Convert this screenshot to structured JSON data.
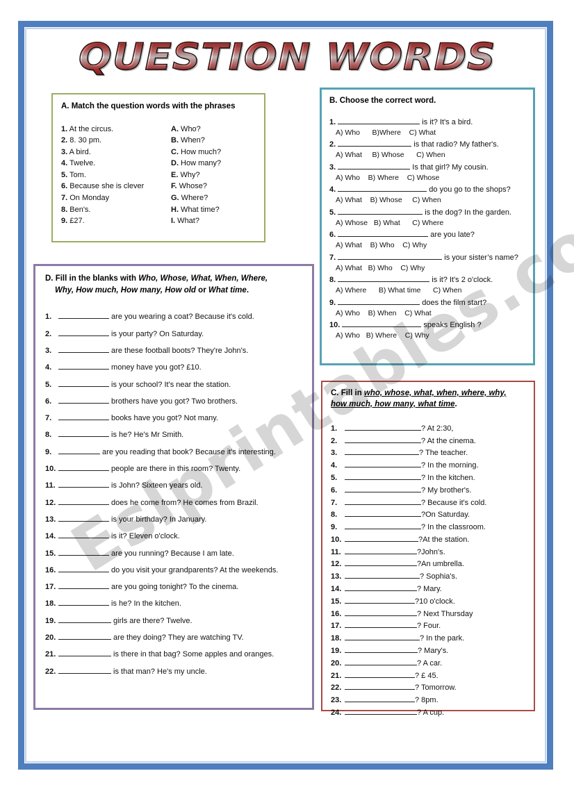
{
  "worksheet": {
    "title": "QUESTION WORDS",
    "watermark": "Eslprintables.com",
    "colors": {
      "frame_blue": "#4f7fbe",
      "box_a_green": "#9aad62",
      "box_b_teal": "#56a2b4",
      "box_c_red": "#a84a45",
      "box_d_purple": "#8c7aa6",
      "title_red": "#c23030"
    }
  },
  "section_a": {
    "heading": "A. Match the question words with the phrases",
    "left_items": [
      {
        "num": "1.",
        "text": "At the circus."
      },
      {
        "num": "2.",
        "text": "8. 30 pm."
      },
      {
        "num": "3.",
        "text": "A bird."
      },
      {
        "num": "4.",
        "text": "Twelve."
      },
      {
        "num": "5.",
        "text": "Tom."
      },
      {
        "num": "6.",
        "text": "Because she is clever"
      },
      {
        "num": "7.",
        "text": "On Monday"
      },
      {
        "num": "8.",
        "text": "Ben's."
      },
      {
        "num": "9.",
        "text": " £27."
      }
    ],
    "right_items": [
      {
        "num": "A.",
        "text": "Who?"
      },
      {
        "num": "B.",
        "text": "When?"
      },
      {
        "num": "C.",
        "text": "How much?"
      },
      {
        "num": "D.",
        "text": "How many?"
      },
      {
        "num": "E.",
        "text": "Why?"
      },
      {
        "num": "F.",
        "text": "Whose?"
      },
      {
        "num": "G.",
        "text": "Where?"
      },
      {
        "num": "H.",
        "text": "What time?"
      },
      {
        "num": "I.",
        "text": "What?"
      }
    ]
  },
  "section_b": {
    "heading": "B. Choose the correct word.",
    "items": [
      {
        "num": "1.",
        "blank_width": 118,
        "tail": "is it? It's a bird.",
        "options": "A) Who      B)Where    C) What"
      },
      {
        "num": "2.",
        "blank_width": 106,
        "tail": "is that radio? My father's.",
        "options": "A) What     B) Whose      C) When"
      },
      {
        "num": "3.",
        "blank_width": 104,
        "tail": "Is that girl? My cousin.",
        "options": "A) Who    B) Where    C) Whose"
      },
      {
        "num": "4.",
        "blank_width": 128,
        "tail": "do you go to the shops?",
        "options": "A) What    B) Whose     C) When"
      },
      {
        "num": "5.",
        "blank_width": 122,
        "tail": "is the dog? In the garden.",
        "options": "A) Whose   B) What      C) Where"
      },
      {
        "num": "6.",
        "blank_width": 130,
        "tail": "are you late?",
        "options": "A) What    B) Who    C) Why"
      },
      {
        "num": "7.",
        "blank_width": 150,
        "tail": "is your sister’s name?",
        "options": "A) What   B) Who    C) Why"
      },
      {
        "num": "8.",
        "blank_width": 132,
        "tail": "is it? It's 2 o'clock.",
        "options": "A) Where      B) What time      C) When"
      },
      {
        "num": "9.",
        "blank_width": 118,
        "tail": "does the film start?",
        "options": "A) Who    B) When    C) What"
      },
      {
        "num": "10.",
        "blank_width": 114,
        "tail": "speaks English ?",
        "options": "A) Who   B) Where    C) Why"
      }
    ]
  },
  "section_c": {
    "heading_prefix": "C. Fill in ",
    "heading_words_line1": "who, whose, what, when, where, why,",
    "heading_words_line2": "how much, how many, what time",
    "heading_suffix": ".",
    "items": [
      {
        "num": "1.",
        "blank_width": 110,
        "answer": "? At  2:30,"
      },
      {
        "num": "2.",
        "blank_width": 110,
        "answer": "? At the cinema."
      },
      {
        "num": "3.",
        "blank_width": 107,
        "answer": "? The teacher."
      },
      {
        "num": "4.",
        "blank_width": 110,
        "answer": "? In the morning."
      },
      {
        "num": "5.",
        "blank_width": 110,
        "answer": "? In the kitchen."
      },
      {
        "num": "6.",
        "blank_width": 110,
        "answer": "? My brother's."
      },
      {
        "num": "7.",
        "blank_width": 110,
        "answer": "? Because it's cold."
      },
      {
        "num": "8.",
        "blank_width": 110,
        "answer": "?On Saturday."
      },
      {
        "num": "9.",
        "blank_width": 110,
        "answer": "? In the classroom."
      },
      {
        "num": "10.",
        "blank_width": 106,
        "answer": "?At the station."
      },
      {
        "num": "11.",
        "blank_width": 104,
        "answer": "?John's."
      },
      {
        "num": "12.",
        "blank_width": 104,
        "answer": "?An umbrella."
      },
      {
        "num": "13.",
        "blank_width": 108,
        "answer": "? Sophia's."
      },
      {
        "num": "14.",
        "blank_width": 104,
        "answer": "? Mary."
      },
      {
        "num": "15.",
        "blank_width": 101,
        "answer": "?10 o'clock."
      },
      {
        "num": "16.",
        "blank_width": 104,
        "answer": "? Next Thursday"
      },
      {
        "num": "17.",
        "blank_width": 104,
        "answer": "? Four."
      },
      {
        "num": "18.",
        "blank_width": 108,
        "answer": "? In the park."
      },
      {
        "num": "19.",
        "blank_width": 105,
        "answer": "? Mary's."
      },
      {
        "num": "20.",
        "blank_width": 104,
        "answer": "? A car."
      },
      {
        "num": "21.",
        "blank_width": 101,
        "answer": "? £ 45."
      },
      {
        "num": "22.",
        "blank_width": 101,
        "answer": "? Tomorrow."
      },
      {
        "num": "23.",
        "blank_width": 101,
        "answer": "? 8pm."
      },
      {
        "num": "24.",
        "blank_width": 104,
        "answer": "? A cup."
      }
    ]
  },
  "section_d": {
    "heading_line1_prefix": "D. Fill in the blanks with ",
    "heading_line1_words": "Who, Whose, What, When, Where,",
    "heading_line2_words_a": "Why, How much, How many, How old",
    "heading_line2_mid": " or ",
    "heading_line2_words_b": "What time",
    "heading_line2_end": ".",
    "items": [
      {
        "num": "1.",
        "blank_width": 73,
        "tail": "are you wearing a coat? Because it's cold."
      },
      {
        "num": "2.",
        "blank_width": 73,
        "tail": "is your party? On Saturday."
      },
      {
        "num": "3.",
        "blank_width": 73,
        "tail": "are these football boots? They're John's."
      },
      {
        "num": "4.",
        "blank_width": 73,
        "tail": "money have you got? £10."
      },
      {
        "num": "5.",
        "blank_width": 73,
        "tail": "is your school? It's near the station."
      },
      {
        "num": "6.",
        "blank_width": 73,
        "tail": "brothers have you got? Two brothers."
      },
      {
        "num": "7.",
        "blank_width": 73,
        "tail": "books have you got? Not many."
      },
      {
        "num": "8.",
        "blank_width": 73,
        "tail": "is he? He's Mr Smith."
      },
      {
        "num": "9.",
        "blank_width": 60,
        "tail": "are you reading that book? Because it's interesting."
      },
      {
        "num": "10.",
        "blank_width": 73,
        "tail": "people are there in this room? Twenty."
      },
      {
        "num": "11.",
        "blank_width": 73,
        "tail": "is John? Sixteen years old."
      },
      {
        "num": "12.",
        "blank_width": 73,
        "tail": "does he come from? He comes from Brazil."
      },
      {
        "num": "13.",
        "blank_width": 73,
        "tail": "is your birthday? In January."
      },
      {
        "num": "14.",
        "blank_width": 73,
        "tail": "is it? Eleven o'clock."
      },
      {
        "num": "15.",
        "blank_width": 73,
        "tail": "are you running? Because I am late."
      },
      {
        "num": "16.",
        "blank_width": 73,
        "tail": "do you visit your grandparents? At the weekends."
      },
      {
        "num": "17.",
        "blank_width": 73,
        "tail": "are you going tonight? To the cinema."
      },
      {
        "num": "18.",
        "blank_width": 73,
        "tail": "is he? In the kitchen."
      },
      {
        "num": "19.",
        "blank_width": 76,
        "tail": "girls are there? Twelve."
      },
      {
        "num": "20.",
        "blank_width": 76,
        "tail": "are they doing? They are watching TV."
      },
      {
        "num": "21.",
        "blank_width": 76,
        "tail": "is there in that bag? Some apples and oranges."
      },
      {
        "num": "22.",
        "blank_width": 76,
        "tail": "is that man? He's my uncle."
      }
    ]
  }
}
